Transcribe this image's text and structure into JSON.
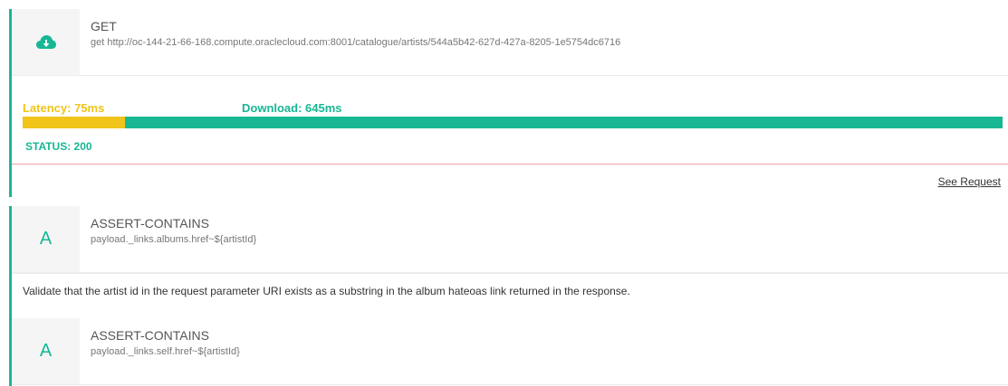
{
  "request": {
    "method": "GET",
    "url_line": "get http://oc-144-21-66-168.compute.oraclecloud.com:8001/catalogue/artists/544a5b42-627d-427a-8205-1e5754dc6716",
    "icon": "cloud-download-icon",
    "latency_label": "Latency: 75ms",
    "download_label": "Download: 645ms",
    "latency_ms": 75,
    "download_ms": 645,
    "status_label": "STATUS: 200",
    "see_request": "See Request"
  },
  "assertions": [
    {
      "letter": "A",
      "title": "ASSERT-CONTAINS",
      "expression": "payload._links.albums.href~${artistId}",
      "description": "Validate that the artist id in the request parameter URI exists as a substring in the album hateoas link returned in the response."
    },
    {
      "letter": "A",
      "title": "ASSERT-CONTAINS",
      "expression": "payload._links.self.href~${artistId}"
    }
  ],
  "colors": {
    "accent": "#17b794",
    "latency": "#f0c419",
    "divider": "#e9a1a1"
  }
}
